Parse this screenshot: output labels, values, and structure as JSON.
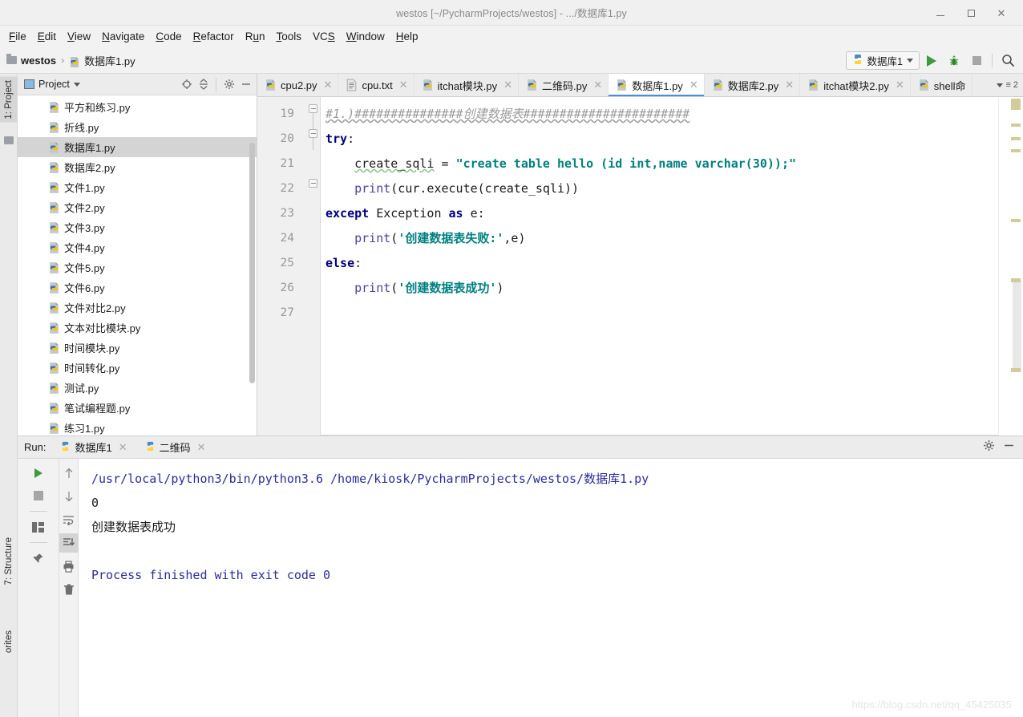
{
  "window": {
    "title": "westos [~/PycharmProjects/westos] - .../数据库1.py",
    "minimize_label": "—",
    "maximize_label": "□",
    "close_label": "✕"
  },
  "menubar": {
    "items": [
      {
        "label": "File",
        "mnemonic": "F"
      },
      {
        "label": "Edit",
        "mnemonic": "E"
      },
      {
        "label": "View",
        "mnemonic": "V"
      },
      {
        "label": "Navigate",
        "mnemonic": "N"
      },
      {
        "label": "Code",
        "mnemonic": "C"
      },
      {
        "label": "Refactor",
        "mnemonic": "R"
      },
      {
        "label": "Run",
        "mnemonic": "u"
      },
      {
        "label": "Tools",
        "mnemonic": "T"
      },
      {
        "label": "VCS",
        "mnemonic": "S"
      },
      {
        "label": "Window",
        "mnemonic": "W"
      },
      {
        "label": "Help",
        "mnemonic": "H"
      }
    ]
  },
  "breadcrumb": {
    "project": "westos",
    "separator": "›",
    "file": "数据库1.py"
  },
  "toolbar": {
    "run_config": "数据库1",
    "run_button": "run-icon",
    "debug_button": "debug-icon",
    "stop_button": "stop-icon",
    "search_button": "search-icon"
  },
  "left_strip": {
    "project_tab": "1: Project",
    "structure_tab": "7: Structure",
    "favorites_tab": "orites"
  },
  "project_panel": {
    "title": "Project",
    "tools": [
      "locate-icon",
      "collapse-all-icon",
      "settings-icon",
      "hide-icon"
    ],
    "files": [
      {
        "name": "平方和练习.py",
        "selected": false
      },
      {
        "name": "折线.py",
        "selected": false
      },
      {
        "name": "数据库1.py",
        "selected": true
      },
      {
        "name": "数据库2.py",
        "selected": false
      },
      {
        "name": "文件1.py",
        "selected": false
      },
      {
        "name": "文件2.py",
        "selected": false
      },
      {
        "name": "文件3.py",
        "selected": false
      },
      {
        "name": "文件4.py",
        "selected": false
      },
      {
        "name": "文件5.py",
        "selected": false
      },
      {
        "name": "文件6.py",
        "selected": false
      },
      {
        "name": "文件对比2.py",
        "selected": false
      },
      {
        "name": "文本对比模块.py",
        "selected": false
      },
      {
        "name": "时间模块.py",
        "selected": false
      },
      {
        "name": "时间转化.py",
        "selected": false
      },
      {
        "name": "测试.py",
        "selected": false
      },
      {
        "name": "笔试编程题.py",
        "selected": false
      },
      {
        "name": "练习1.py",
        "selected": false
      }
    ]
  },
  "editor_tabs": {
    "tabs": [
      {
        "label": "cpu2.py",
        "icon": "python-file-icon",
        "active": false,
        "closable": true
      },
      {
        "label": "cpu.txt",
        "icon": "text-file-icon",
        "active": false,
        "closable": true
      },
      {
        "label": "itchat模块.py",
        "icon": "python-file-icon",
        "active": false,
        "closable": true
      },
      {
        "label": "二维码.py",
        "icon": "python-file-icon",
        "active": false,
        "closable": true
      },
      {
        "label": "数据库1.py",
        "icon": "python-file-icon",
        "active": true,
        "closable": true
      },
      {
        "label": "数据库2.py",
        "icon": "python-file-icon",
        "active": false,
        "closable": true
      },
      {
        "label": "itchat模块2.py",
        "icon": "python-file-icon",
        "active": false,
        "closable": true
      },
      {
        "label": "shell命",
        "icon": "python-file-icon",
        "active": false,
        "closable": false
      }
    ],
    "overflow_label": "2"
  },
  "editor": {
    "line_numbers": [
      "19",
      "20",
      "21",
      "22",
      "23",
      "24",
      "25",
      "26",
      "27"
    ],
    "lines": [
      {
        "n": "19",
        "tokens": [
          {
            "t": "#1.)###############创建数据表#######################",
            "c": "cmt"
          }
        ]
      },
      {
        "n": "20",
        "tokens": [
          {
            "t": "try",
            "c": "kw"
          },
          {
            "t": ":",
            "c": "pl"
          }
        ]
      },
      {
        "n": "21",
        "tokens": [
          {
            "t": "    create_sqli",
            "c": "pl"
          },
          {
            "t": " = ",
            "c": "pl"
          },
          {
            "t": "\"create table hello (id int,name varchar(30));\"",
            "c": "str"
          }
        ]
      },
      {
        "n": "22",
        "tokens": [
          {
            "t": "    ",
            "c": "pl"
          },
          {
            "t": "print",
            "c": "fn"
          },
          {
            "t": "(cur.execute(create_sqli))",
            "c": "pl"
          }
        ]
      },
      {
        "n": "23",
        "tokens": [
          {
            "t": "except",
            "c": "kw"
          },
          {
            "t": " Exception ",
            "c": "pl"
          },
          {
            "t": "as",
            "c": "kw"
          },
          {
            "t": " e:",
            "c": "pl"
          }
        ]
      },
      {
        "n": "24",
        "tokens": [
          {
            "t": "    ",
            "c": "pl"
          },
          {
            "t": "print",
            "c": "fn"
          },
          {
            "t": "(",
            "c": "pl"
          },
          {
            "t": "'创建数据表失败:'",
            "c": "str"
          },
          {
            "t": ",e)",
            "c": "pl"
          }
        ]
      },
      {
        "n": "25",
        "tokens": [
          {
            "t": "else",
            "c": "kw"
          },
          {
            "t": ":",
            "c": "pl"
          }
        ]
      },
      {
        "n": "26",
        "tokens": [
          {
            "t": "    ",
            "c": "pl"
          },
          {
            "t": "print",
            "c": "fn"
          },
          {
            "t": "(",
            "c": "pl"
          },
          {
            "t": "'创建数据表成功'",
            "c": "str"
          },
          {
            "t": ")",
            "c": "pl"
          }
        ]
      },
      {
        "n": "27",
        "tokens": []
      }
    ]
  },
  "run_panel": {
    "label": "Run:",
    "tabs": [
      {
        "label": "数据库1",
        "active": true
      },
      {
        "label": "二维码",
        "active": false
      }
    ],
    "left_tools": [
      "rerun-icon",
      "stop-icon",
      "layout-icon",
      "pin-icon"
    ],
    "right_tools": [
      "up-icon",
      "down-icon",
      "soft-wrap-icon",
      "scroll-to-end-icon",
      "print-icon",
      "trash-icon"
    ],
    "header_tools": [
      "settings-icon",
      "hide-icon"
    ],
    "console": [
      {
        "text": "/usr/local/python3/bin/python3.6 /home/kiosk/PycharmProjects/westos/数据库1.py",
        "style": "cmd"
      },
      {
        "text": "0",
        "style": "out"
      },
      {
        "text": "创建数据表成功",
        "style": "out"
      },
      {
        "text": "",
        "style": "out"
      },
      {
        "text": "Process finished with exit code 0",
        "style": "exit"
      }
    ]
  },
  "watermark": {
    "text": "https://blog.csdn.net/qq_45425035"
  },
  "colors": {
    "keyword": "#000080",
    "string": "#008080",
    "function": "#4b3fa0",
    "comment": "#9a9a9a",
    "console_blue": "#2b2b9e",
    "accent": "#4a90d9",
    "marker": "#d2cc9a"
  }
}
